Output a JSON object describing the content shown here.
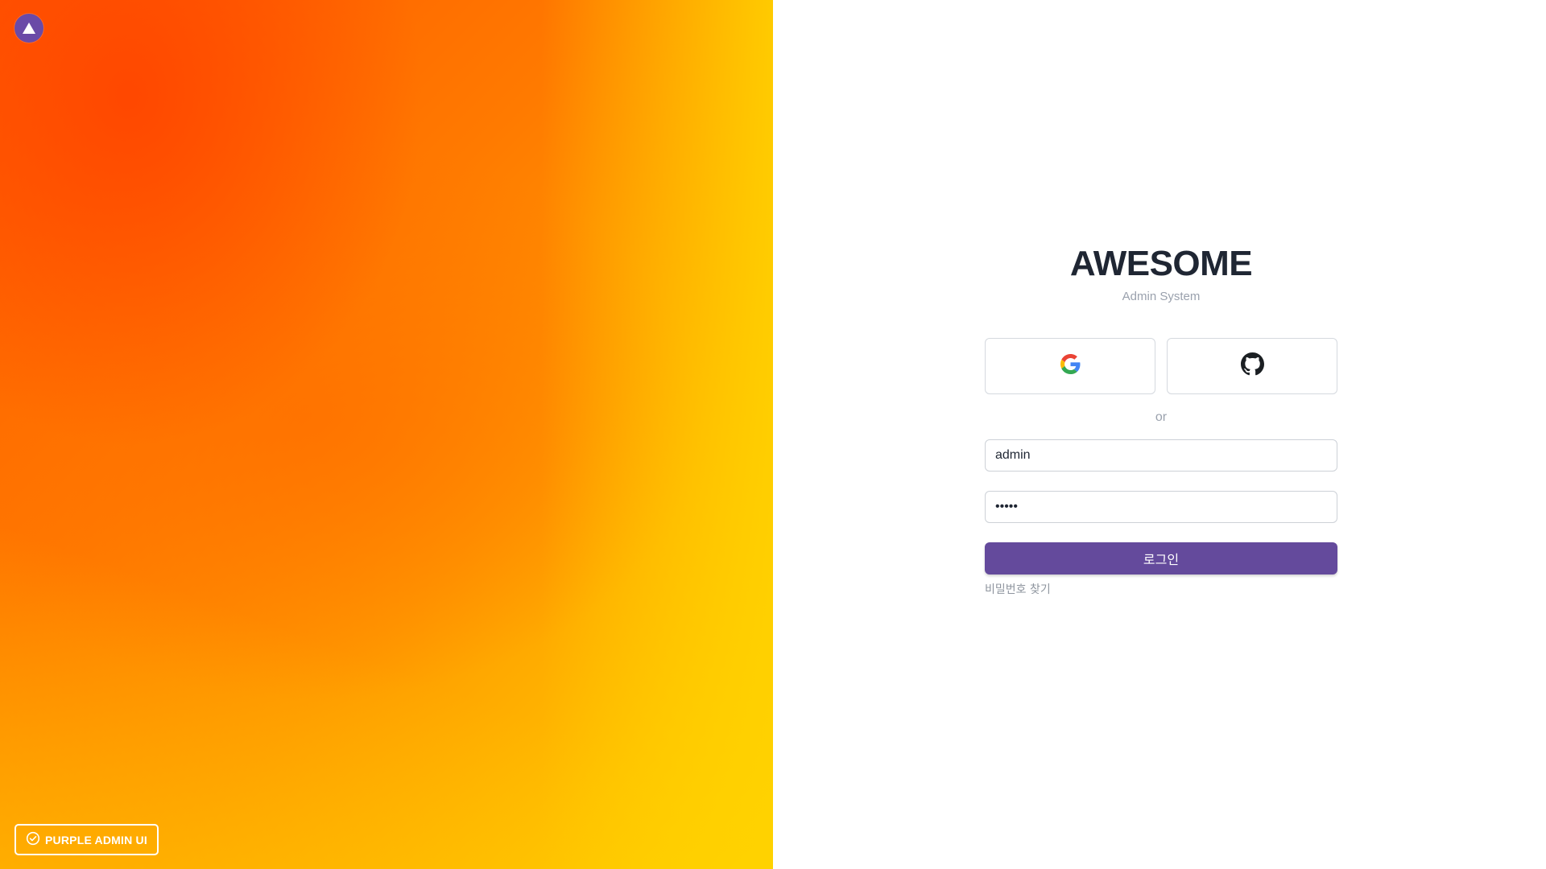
{
  "brand": {
    "logo_icon": "triangle-logo-icon",
    "logo_color": "#6a4aa7",
    "badge_icon": "check-circle-icon",
    "badge_label": "PURPLE ADMIN UI"
  },
  "login": {
    "title": "AWESOME",
    "subtitle": "Admin System",
    "social": {
      "google_icon": "google-icon",
      "github_icon": "github-icon"
    },
    "divider": "or",
    "username": {
      "value": "admin",
      "placeholder": ""
    },
    "password": {
      "value": "admin",
      "placeholder": ""
    },
    "submit_label": "로그인",
    "forgot_label": "비밀번호 찾기",
    "accent_color": "#644a9c"
  }
}
